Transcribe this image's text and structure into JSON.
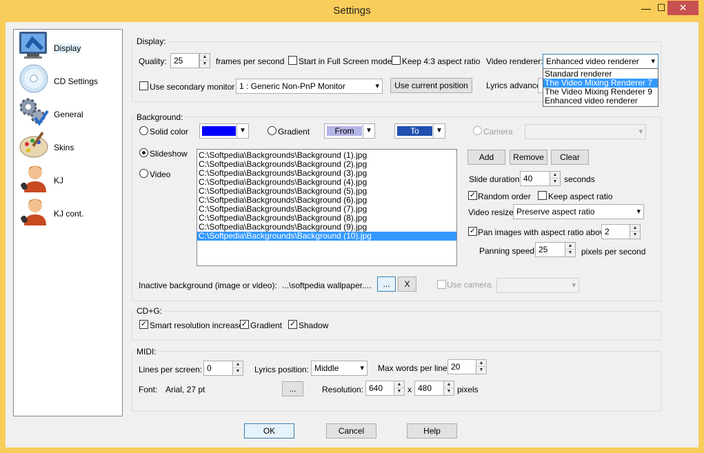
{
  "window": {
    "title": "Settings",
    "minimize": "—",
    "maximize": "☐",
    "close": "✕",
    "accent": "#f9cd59"
  },
  "sidebar": {
    "items": [
      {
        "label": "Display",
        "icon": "monitor-icon"
      },
      {
        "label": "CD Settings",
        "icon": "cd-icon"
      },
      {
        "label": "General",
        "icon": "gears-icon"
      },
      {
        "label": "Skins",
        "icon": "palette-icon"
      },
      {
        "label": "KJ",
        "icon": "singer-icon"
      },
      {
        "label": "KJ cont.",
        "icon": "singer-icon"
      }
    ]
  },
  "display": {
    "group_label": "Display:",
    "quality_label": "Quality:",
    "quality_value": "25",
    "fps_label": "frames per second",
    "fullscreen_label": "Start in Full Screen mode",
    "aspect_label": "Keep 4:3 aspect ratio",
    "renderer_label": "Video renderer:",
    "renderer_value": "Enhanced video renderer",
    "renderer_options": [
      "Standard renderer",
      "The Video Mixing Renderer 7",
      "The Video Mixing Renderer 9",
      "Enhanced video renderer"
    ],
    "secondary_label": "Use secondary monitor",
    "monitor_value": "1 : Generic Non-PnP Monitor",
    "use_position_label": "Use current position",
    "lyrics_advance_label": "Lyrics advance:"
  },
  "background": {
    "group_label": "Background:",
    "solid_label": "Solid color",
    "solid_color": "#0000ff",
    "gradient_label": "Gradient",
    "from_label": "From",
    "from_color": "#b4b4e6",
    "to_label": "To",
    "to_color": "#2050b0",
    "camera_label": "Camera",
    "slideshow_label": "Slideshow",
    "video_label": "Video",
    "files": [
      "C:\\Softpedia\\Backgrounds\\Background (1).jpg",
      "C:\\Softpedia\\Backgrounds\\Background (2).jpg",
      "C:\\Softpedia\\Backgrounds\\Background (3).jpg",
      "C:\\Softpedia\\Backgrounds\\Background (4).jpg",
      "C:\\Softpedia\\Backgrounds\\Background (5).jpg",
      "C:\\Softpedia\\Backgrounds\\Background (6).jpg",
      "C:\\Softpedia\\Backgrounds\\Background (7).jpg",
      "C:\\Softpedia\\Backgrounds\\Background (8).jpg",
      "C:\\Softpedia\\Backgrounds\\Background (9).jpg",
      "C:\\Softpedia\\Backgrounds\\Background (10).jpg"
    ],
    "add_label": "Add",
    "remove_label": "Remove",
    "clear_label": "Clear",
    "slide_duration_label": "Slide duration:",
    "slide_duration_value": "40",
    "seconds_label": "seconds",
    "random_label": "Random order",
    "keep_aspect_label": "Keep aspect ratio",
    "resize_label": "Video resize:",
    "resize_value": "Preserve aspect ratio",
    "pan_label": "Pan images with aspect ratio above",
    "pan_value": "2",
    "panning_speed_label": "Panning speed:",
    "panning_speed_value": "25",
    "pps_label": "pixels per second",
    "inactive_label": "Inactive background (image or video):",
    "inactive_value": "...\\softpedia wallpaper....",
    "browse_label": "...",
    "clear_x_label": "X",
    "use_camera_label": "Use camera"
  },
  "cdg": {
    "group_label": "CD+G:",
    "smart_label": "Smart resolution increase",
    "gradient_label": "Gradient",
    "shadow_label": "Shadow"
  },
  "midi": {
    "group_label": "MIDI:",
    "lines_label": "Lines per screen:",
    "lines_value": "0",
    "position_label": "Lyrics position:",
    "position_value": "Middle",
    "max_words_label": "Max words per line:",
    "max_words_value": "20",
    "font_label": "Font:",
    "font_value": "Arial, 27 pt",
    "font_button": "...",
    "resolution_label": "Resolution:",
    "res_w": "640",
    "x_label": "x",
    "res_h": "480",
    "pixels_label": "pixels"
  },
  "footer": {
    "ok": "OK",
    "cancel": "Cancel",
    "help": "Help"
  }
}
